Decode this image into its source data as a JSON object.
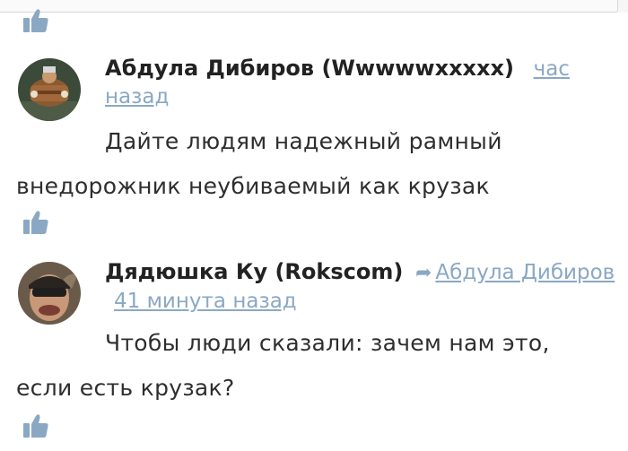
{
  "comments": [
    {
      "author": "Абдула Дибиров (Wwwwwxxxxx)",
      "time": "час назад",
      "text": "Дайте людям надежный рамный внедорожник неубиваемый как крузак"
    },
    {
      "author": "Дядюшка Ку (Rokscom)",
      "reply_to": "Абдула Дибиров",
      "time": "41 минута назад",
      "text": "Чтобы люди сказали: зачем нам это, если есть крузак?"
    }
  ],
  "colors": {
    "link": "#8aa8c4",
    "like_icon": "#8aa8c4",
    "author": "#222222"
  },
  "icons": {
    "like": "thumbs-up-icon",
    "reply": "reply-arrow-icon"
  }
}
